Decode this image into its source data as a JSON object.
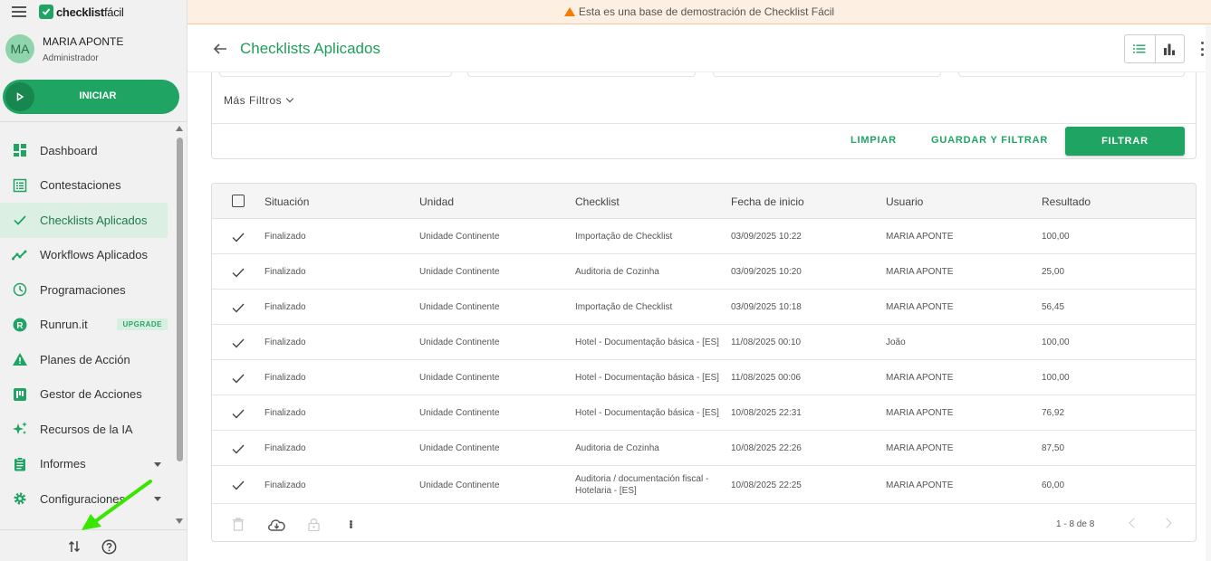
{
  "app": {
    "logo_bold": "checklist",
    "logo_light": "fácil"
  },
  "user": {
    "initials": "MA",
    "name": "MARIA APONTE",
    "role": "Administrador"
  },
  "start_button": {
    "label": "INICIAR"
  },
  "nav": {
    "items": [
      {
        "label": "Dashboard",
        "icon": "dashboard-icon"
      },
      {
        "label": "Contestaciones",
        "icon": "list-icon"
      },
      {
        "label": "Checklists Aplicados",
        "icon": "check-icon",
        "active": true
      },
      {
        "label": "Workflows Aplicados",
        "icon": "trending-icon"
      },
      {
        "label": "Programaciones",
        "icon": "clock-icon"
      },
      {
        "label": "Runrun.it",
        "icon": "runrunit-icon",
        "badge": "UPGRADE"
      },
      {
        "label": "Planes de Acción",
        "icon": "warning-icon"
      },
      {
        "label": "Gestor de Acciones",
        "icon": "kanban-icon"
      },
      {
        "label": "Recursos de la IA",
        "icon": "sparkle-icon"
      },
      {
        "label": "Informes",
        "icon": "clipboard-icon",
        "expandable": true
      },
      {
        "label": "Configuraciones",
        "icon": "gear-icon",
        "expandable": true
      }
    ]
  },
  "banner": {
    "text": "Esta es una base de demostración de Checklist Fácil"
  },
  "header": {
    "title": "Checklists Aplicados"
  },
  "filters": {
    "more_filters": "Más Filtros",
    "clear": "LIMPIAR",
    "save_filter": "GUARDAR Y FILTRAR",
    "filter": "FILTRAR"
  },
  "table": {
    "columns": [
      "Situación",
      "Unidad",
      "Checklist",
      "Fecha de inicio",
      "Usuario",
      "Resultado"
    ],
    "rows": [
      {
        "status": "Finalizado",
        "unit": "Unidade Continente",
        "checklist": "Importação de Checklist",
        "date": "03/09/2025 10:22",
        "user": "MARIA APONTE",
        "result": "100,00"
      },
      {
        "status": "Finalizado",
        "unit": "Unidade Continente",
        "checklist": "Auditoria de Cozinha",
        "date": "03/09/2025 10:20",
        "user": "MARIA APONTE",
        "result": "25,00"
      },
      {
        "status": "Finalizado",
        "unit": "Unidade Continente",
        "checklist": "Importação de Checklist",
        "date": "03/09/2025 10:18",
        "user": "MARIA APONTE",
        "result": "56,45"
      },
      {
        "status": "Finalizado",
        "unit": "Unidade Continente",
        "checklist": "Hotel - Documentação básica - [ES]",
        "date": "11/08/2025 00:10",
        "user": "João",
        "result": "100,00"
      },
      {
        "status": "Finalizado",
        "unit": "Unidade Continente",
        "checklist": "Hotel - Documentação básica - [ES]",
        "date": "11/08/2025 00:06",
        "user": "MARIA APONTE",
        "result": "100,00"
      },
      {
        "status": "Finalizado",
        "unit": "Unidade Continente",
        "checklist": "Hotel - Documentação básica - [ES]",
        "date": "10/08/2025 22:31",
        "user": "MARIA APONTE",
        "result": "76,92"
      },
      {
        "status": "Finalizado",
        "unit": "Unidade Continente",
        "checklist": "Auditoria de Cozinha",
        "date": "10/08/2025 22:26",
        "user": "MARIA APONTE",
        "result": "87,50"
      },
      {
        "status": "Finalizado",
        "unit": "Unidade Continente",
        "checklist": "Auditoria / documentación fiscal - Hotelaria - [ES]",
        "date": "10/08/2025 22:25",
        "user": "MARIA APONTE",
        "result": "60,00"
      }
    ],
    "pagination": "1 - 8 de 8"
  },
  "colors": {
    "brand_green": "#1fa463",
    "banner_bg": "#fdefe2",
    "warning_orange": "#f57c00",
    "annotation_arrow": "#39e600"
  }
}
